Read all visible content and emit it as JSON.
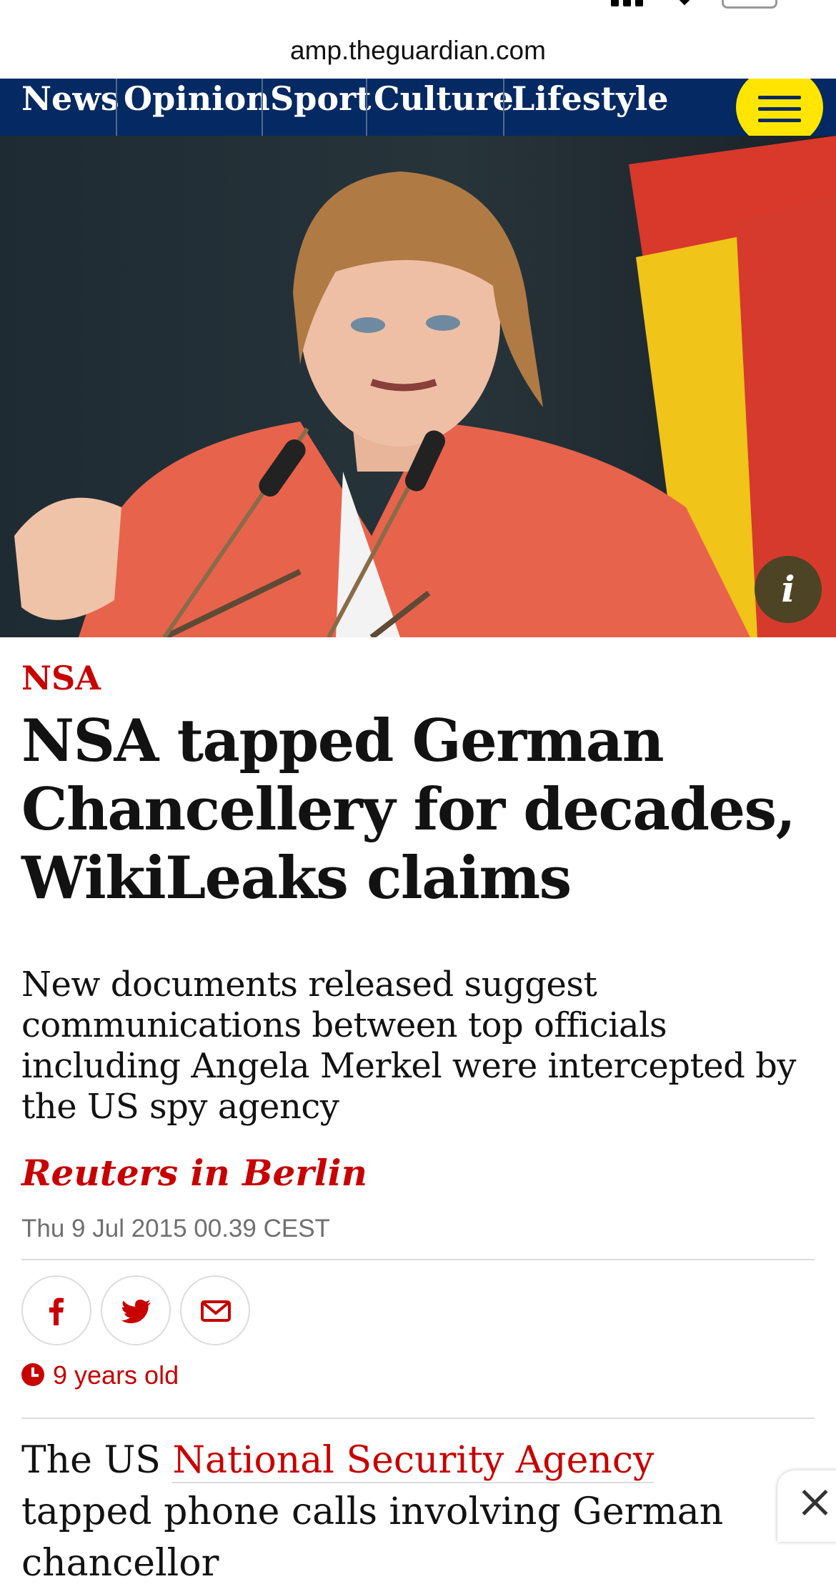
{
  "browser": {
    "url": "amp.theguardian.com"
  },
  "nav": {
    "items": [
      {
        "label": "News"
      },
      {
        "label": "Opinion"
      },
      {
        "label": "Sport"
      },
      {
        "label": "Culture"
      },
      {
        "label": "Lifestyle"
      }
    ],
    "menu_icon": "hamburger-icon"
  },
  "hero": {
    "info_label": "i"
  },
  "article": {
    "kicker": "NSA",
    "headline": "NSA tapped German Chancellery for decades, WikiLeaks claims",
    "standfirst": "New documents released suggest communications between top officials including Angela Merkel were intercepted by the US spy agency",
    "byline": "Reuters in Berlin",
    "date": "Thu 9 Jul 2015 00.39 CEST",
    "share": [
      {
        "icon": "facebook-icon"
      },
      {
        "icon": "twitter-icon"
      },
      {
        "icon": "email-icon"
      }
    ],
    "age": "9 years old",
    "body_prefix": "The US ",
    "body_link": "National Security Agency",
    "body_suffix": " tapped phone calls involving German chancellor"
  },
  "colors": {
    "nav_bg": "#052962",
    "accent": "#c70000",
    "menu_button": "#ffe500"
  }
}
